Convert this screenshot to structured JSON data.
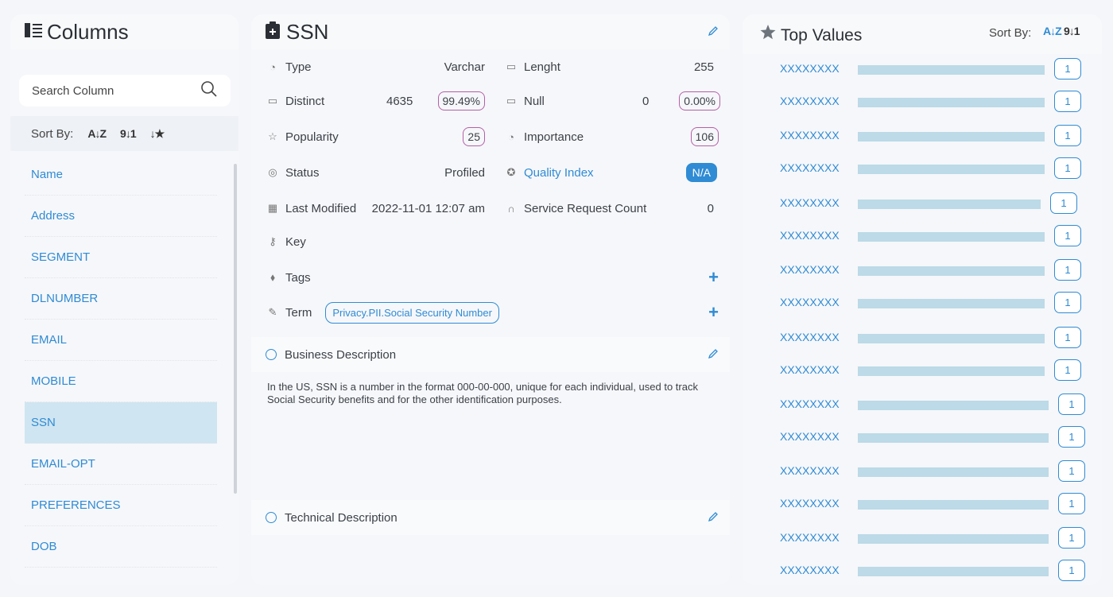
{
  "columns_panel": {
    "title": "Columns",
    "search_placeholder": "Search Column",
    "sort_label": "Sort By:",
    "items": [
      "Name",
      "Address",
      "SEGMENT",
      "DLNUMBER",
      "EMAIL",
      "MOBILE",
      "SSN",
      "EMAIL-OPT",
      "PREFERENCES",
      "DOB"
    ],
    "active_item": "SSN"
  },
  "detail": {
    "title": "SSN",
    "type_label": "Type",
    "type_value": "Varchar",
    "length_label": "Lenght",
    "length_value": "255",
    "distinct_label": "Distinct",
    "distinct_value": "4635",
    "distinct_pct": "99.49%",
    "null_label": "Null",
    "null_value": "0",
    "null_pct": "0.00%",
    "popularity_label": "Popularity",
    "popularity_value": "25",
    "importance_label": "Importance",
    "importance_value": "106",
    "status_label": "Status",
    "status_value": "Profiled",
    "quality_label": "Quality Index",
    "quality_value": "N/A",
    "modified_label": "Last Modified",
    "modified_value": "2022-11-01 12:07 am",
    "service_label": "Service Request Count",
    "service_value": "0",
    "key_label": "Key",
    "tags_label": "Tags",
    "term_label": "Term",
    "term_value": "Privacy.PII.Social Security Number",
    "business_label": "Business Description",
    "business_text": "In the US, SSN is a number in the format 000-00-000, unique for each individual, used to track Social Security benefits and for the other identification purposes.",
    "technical_label": "Technical Description"
  },
  "top_values": {
    "title": "Top Values",
    "sort_label": "Sort By:",
    "items": [
      {
        "name": "XXXXXXXX",
        "count": "1",
        "fill": 0.98
      },
      {
        "name": "XXXXXXXX",
        "count": "1",
        "fill": 0.98
      },
      {
        "name": "XXXXXXXX",
        "count": "1",
        "fill": 0.98
      },
      {
        "name": "XXXXXXXX",
        "count": "1",
        "fill": 0.98
      },
      {
        "name": "XXXXXXXX",
        "count": "1",
        "fill": 0.96
      },
      {
        "name": "XXXXXXXX",
        "count": "1",
        "fill": 0.98
      },
      {
        "name": "XXXXXXXX",
        "count": "1",
        "fill": 0.98
      },
      {
        "name": "XXXXXXXX",
        "count": "1",
        "fill": 0.98
      },
      {
        "name": "XXXXXXXX",
        "count": "1",
        "fill": 0.98
      },
      {
        "name": "XXXXXXXX",
        "count": "1",
        "fill": 0.98
      },
      {
        "name": "XXXXXXXX",
        "count": "1",
        "fill": 1.0
      },
      {
        "name": "XXXXXXXX",
        "count": "1",
        "fill": 1.0
      },
      {
        "name": "XXXXXXXX",
        "count": "1",
        "fill": 1.0
      },
      {
        "name": "XXXXXXXX",
        "count": "1",
        "fill": 1.0
      },
      {
        "name": "XXXXXXXX",
        "count": "1",
        "fill": 1.0
      },
      {
        "name": "XXXXXXXX",
        "count": "1",
        "fill": 1.0
      }
    ]
  }
}
